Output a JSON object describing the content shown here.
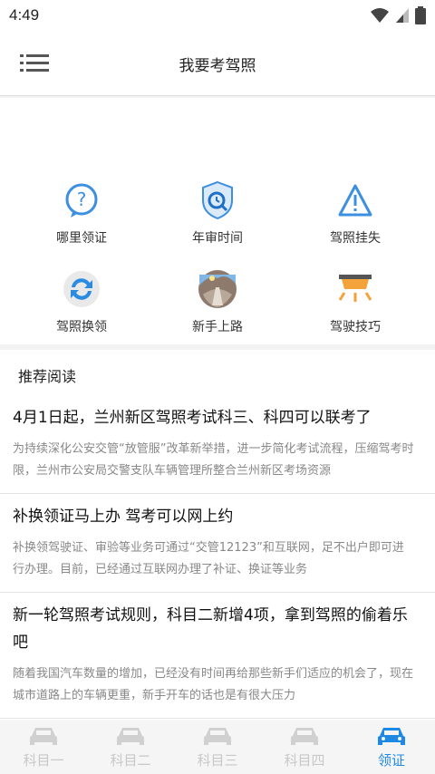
{
  "status": {
    "time": "4:49"
  },
  "header": {
    "title": "我要考驾照"
  },
  "grid": [
    {
      "label": "哪里领证",
      "icon": "question-bubble-icon"
    },
    {
      "label": "年审时间",
      "icon": "shield-clock-icon"
    },
    {
      "label": "驾照挂失",
      "icon": "warning-triangle-icon"
    },
    {
      "label": "驾照换领",
      "icon": "refresh-icon"
    },
    {
      "label": "新手上路",
      "icon": "road-photo-icon"
    },
    {
      "label": "驾驶技巧",
      "icon": "car-light-icon"
    }
  ],
  "articles": {
    "section_title": "推荐阅读",
    "items": [
      {
        "title": "4月1日起，兰州新区驾照考试科三、科四可以联考了",
        "body": "为持续深化公安交管“放管服”改革新举措，进一步简化考试流程，压缩驾考时限，兰州市公安局交警支队车辆管理所整合兰州新区考场资源"
      },
      {
        "title": "补换领证马上办 驾考可以网上约",
        "body": "补换领驾驶证、审验等业务可通过“交管12123”和互联网，足不出户即可进行办理。目前，已经通过互联网办理了补证、换证等业务"
      },
      {
        "title": "新一轮驾照考试规则，科目二新增4项，拿到驾照的偷着乐吧",
        "body": "随着我国汽车数量的增加，已经没有时间再给那些新手们适应的机会了，现在城市道路上的车辆更重，新手开车的话也是有很大压力"
      }
    ]
  },
  "tabs": [
    {
      "label": "科目一",
      "active": false
    },
    {
      "label": "科目二",
      "active": false
    },
    {
      "label": "科目三",
      "active": false
    },
    {
      "label": "科目四",
      "active": false
    },
    {
      "label": "领证",
      "active": true
    }
  ],
  "colors": {
    "accent": "#1e88e5",
    "inactive_tab": "#c8c8c8"
  }
}
